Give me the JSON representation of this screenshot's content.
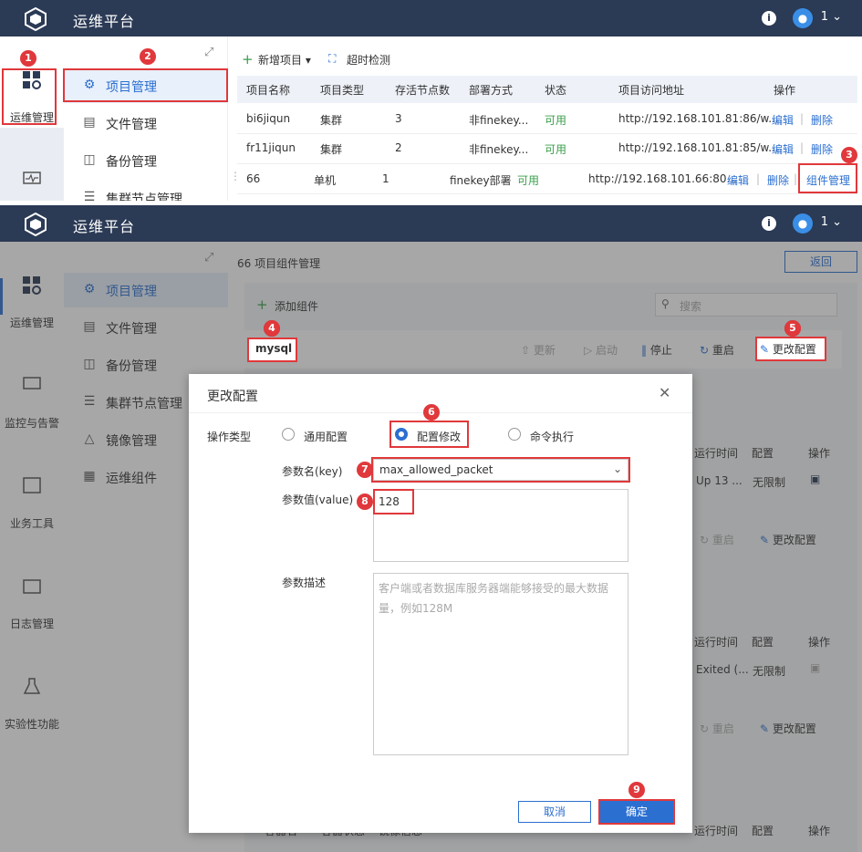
{
  "app": {
    "title": "运维平台",
    "user": "1",
    "info_glyph": "i"
  },
  "rail": {
    "ops": "运维管理",
    "monitor": "监控与告警",
    "tools": "业务工具",
    "logs": "日志管理",
    "lab": "实验性功能"
  },
  "sidebar": {
    "project": "项目管理",
    "file": "文件管理",
    "backup": "备份管理",
    "cluster": "集群节点管理",
    "image": "镜像管理",
    "component": "运维组件"
  },
  "toolbar": {
    "new_project": "新增项目",
    "timeout_check": "超时检测"
  },
  "table": {
    "headers": [
      "项目名称",
      "项目类型",
      "存活节点数",
      "部署方式",
      "状态",
      "项目访问地址",
      "操作"
    ],
    "rows": [
      {
        "name": "bi6jiqun",
        "type": "集群",
        "nodes": "3",
        "deploy": "非finekey...",
        "status": "可用",
        "url": "http://192.168.101.81:86/w...",
        "edit": "编辑",
        "del": "删除"
      },
      {
        "name": "fr11jiqun",
        "type": "集群",
        "nodes": "2",
        "deploy": "非finekey...",
        "status": "可用",
        "url": "http://192.168.101.81:85/w...",
        "edit": "编辑",
        "del": "删除"
      },
      {
        "name": "66",
        "type": "单机",
        "nodes": "1",
        "deploy": "finekey部署",
        "status": "可用",
        "url": "http://192.168.101.66:80...",
        "edit": "编辑",
        "del": "删除",
        "component": "组件管理"
      }
    ]
  },
  "component_page": {
    "breadcrumb": "66 项目组件管理",
    "back": "返回",
    "add": "添加组件",
    "search_placeholder": "搜索",
    "mysql": "mysql",
    "update": "更新",
    "start": "启动",
    "stop": "停止",
    "restart": "重启",
    "change_config": "更改配置",
    "col_runtime": "运行时间",
    "col_config": "配置",
    "col_action": "操作",
    "row1_runtime": "Up 13 ...",
    "row1_config": "无限制",
    "row2_runtime": "Exited (...",
    "row2_config": "无限制",
    "bottom_col_a": "容器名",
    "bottom_col_b": "容器状态",
    "bottom_col_c": "镜像信息"
  },
  "dialog": {
    "title": "更改配置",
    "op_type_label": "操作类型",
    "opt_general": "通用配置",
    "opt_modify": "配置修改",
    "opt_cmd": "命令执行",
    "key_label": "参数名(key)",
    "key_value": "max_allowed_packet",
    "value_label": "参数值(value)",
    "value_value": "128",
    "desc_label": "参数描述",
    "desc_value": "客户端或者数据库服务器端能够接受的最大数据量，例如128M",
    "cancel": "取消",
    "ok": "确定"
  },
  "badges": [
    "1",
    "2",
    "3",
    "4",
    "5",
    "6",
    "7",
    "8",
    "9"
  ],
  "colors": {
    "topbar": "#2b3a55",
    "accent": "#2b6fd1",
    "annot": "#e0383b",
    "ok_green": "#3a9e4a"
  }
}
